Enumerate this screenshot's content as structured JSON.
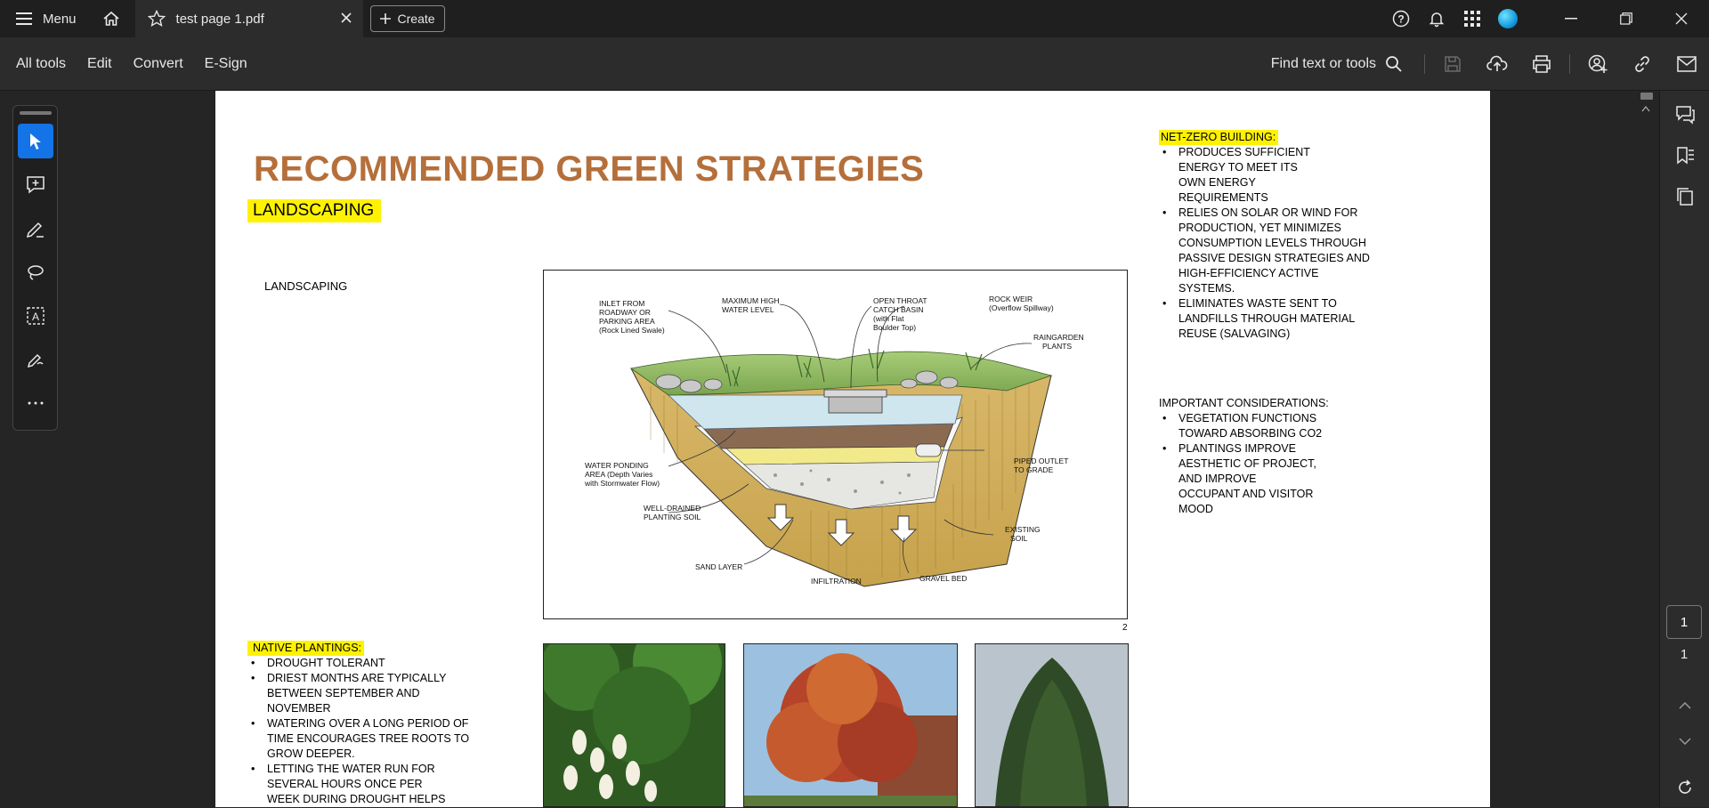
{
  "titlebar": {
    "menu_label": "Menu",
    "tab_title": "test page 1.pdf",
    "create_label": "Create"
  },
  "toolbar": {
    "tabs": [
      "All tools",
      "Edit",
      "Convert",
      "E-Sign"
    ],
    "find_label": "Find text or tools"
  },
  "document": {
    "title": "RECOMMENDED GREEN STRATEGIES",
    "section_heading": "LANDSCAPING",
    "left_label": "LANDSCAPING",
    "page_number_mark": "2",
    "diagram_labels": {
      "inlet": [
        "INLET FROM",
        "ROADWAY OR",
        "PARKING AREA",
        "(Rock Lined Swale)"
      ],
      "max_water": [
        "MAXIMUM HIGH",
        "WATER LEVEL"
      ],
      "catch_basin": [
        "OPEN THROAT",
        "CATCH BASIN",
        "(with Flat",
        "Boulder Top)"
      ],
      "rock_weir": [
        "ROCK WEIR",
        "(Overflow Spillway)"
      ],
      "raingarden": [
        "RAINGARDEN",
        "PLANTS"
      ],
      "ponding": [
        "WATER PONDING",
        "AREA (Depth Varies",
        "with Stormwater Flow)"
      ],
      "piped_outlet": [
        "PIPED OUTLET",
        "TO GRADE"
      ],
      "soil": [
        "WELL-DRAINED",
        "PLANTING SOIL"
      ],
      "existing": [
        "EXISTING",
        "SOIL"
      ],
      "sand": "SAND LAYER",
      "infiltration": "INFILTRATION",
      "gravel": "GRAVEL BED"
    },
    "native": {
      "heading": "NATIVE PLANTINGS:",
      "items": [
        "DROUGHT TOLERANT",
        "DRIEST MONTHS ARE TYPICALLY BETWEEN SEPTEMBER AND NOVEMBER",
        "WATERING OVER A LONG PERIOD OF TIME ENCOURAGES TREE ROOTS TO GROW DEEPER.",
        "LETTING THE WATER RUN FOR SEVERAL HOURS ONCE PER WEEK DURING DROUGHT HELPS IMPROVE TREE SURVIVAL."
      ]
    },
    "netzero": {
      "heading": "NET-ZERO BUILDING:",
      "items": [
        "PRODUCES SUFFICIENT ENERGY TO MEET ITS OWN ENERGY REQUIREMENTS",
        "RELIES ON SOLAR OR WIND FOR PRODUCTION, YET MINIMIZES CONSUMPTION LEVELS THROUGH PASSIVE DESIGN STRATEGIES AND HIGH-EFFICIENCY ACTIVE SYSTEMS.",
        "ELIMINATES WASTE SENT TO LANDFILLS THROUGH MATERIAL REUSE (SALVAGING)"
      ]
    },
    "considerations": {
      "heading": "IMPORTANT CONSIDERATIONS:",
      "items": [
        "VEGETATION FUNCTIONS TOWARD ABSORBING CO2",
        "PLANTINGS IMPROVE AESTHETIC OF PROJECT, AND IMPROVE OCCUPANT AND VISITOR MOOD"
      ]
    }
  },
  "pager": {
    "current": "1",
    "total": "1"
  },
  "colors": {
    "accent": "#1473e6",
    "title_brown": "#b56f3a",
    "highlight": "#fff200"
  }
}
